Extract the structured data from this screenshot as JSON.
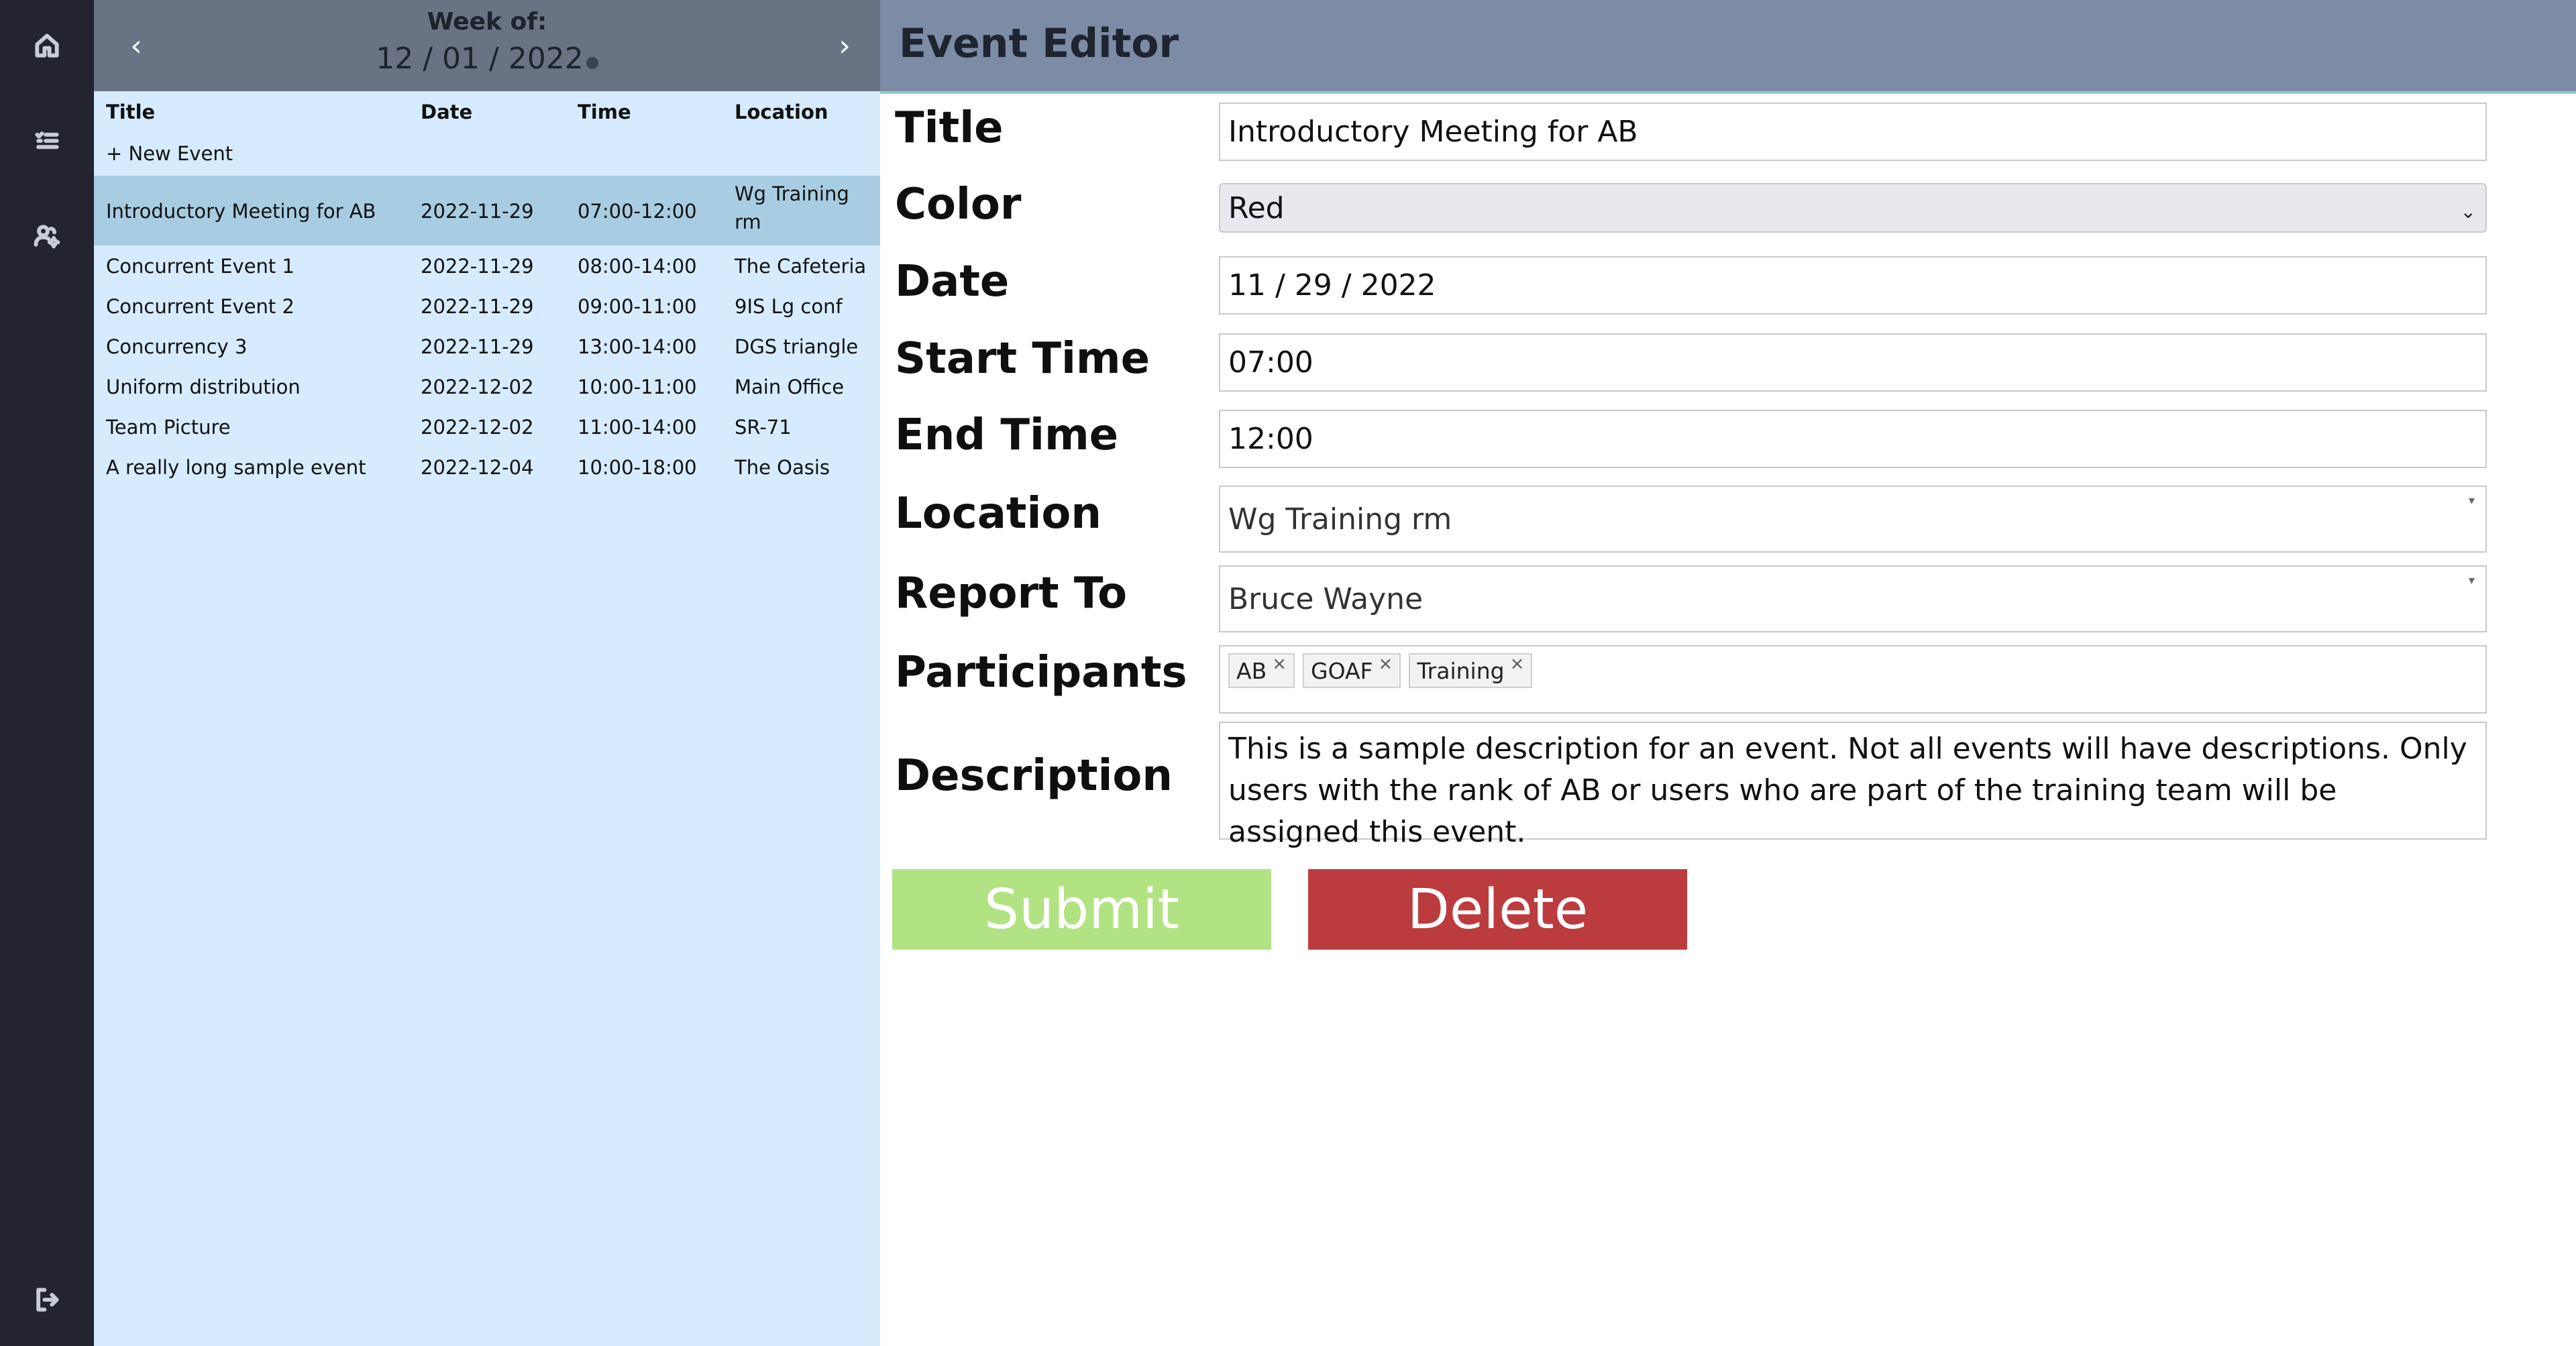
{
  "nav": {
    "items": [
      {
        "name": "home-icon"
      },
      {
        "name": "event-list-icon"
      },
      {
        "name": "users-settings-icon"
      }
    ],
    "bottom": {
      "name": "logout-icon"
    }
  },
  "week": {
    "label": "Week of:",
    "date": "12 / 01 / 2022",
    "prev_icon": "‹",
    "next_icon": "›"
  },
  "table": {
    "headers": {
      "title": "Title",
      "date": "Date",
      "time": "Time",
      "location": "Location"
    },
    "new_event": "+ New Event",
    "rows": [
      {
        "title": "Introductory Meeting for AB",
        "date": "2022-11-29",
        "time": "07:00-12:00",
        "location_line1": "Wg Training",
        "location_line2": "rm"
      },
      {
        "title": "Concurrent Event 1",
        "date": "2022-11-29",
        "time": "08:00-14:00",
        "location_line1": "The Cafeteria"
      },
      {
        "title": "Concurrent Event 2",
        "date": "2022-11-29",
        "time": "09:00-11:00",
        "location_line1": "9IS Lg conf"
      },
      {
        "title": "Concurrency 3",
        "date": "2022-11-29",
        "time": "13:00-14:00",
        "location_line1": "DGS triangle"
      },
      {
        "title": "Uniform distribution",
        "date": "2022-12-02",
        "time": "10:00-11:00",
        "location_line1": "Main Office"
      },
      {
        "title": "Team Picture",
        "date": "2022-12-02",
        "time": "11:00-14:00",
        "location_line1": "SR-71"
      },
      {
        "title": "A really long sample event",
        "date": "2022-12-04",
        "time": "10:00-18:00",
        "location_line1": "The Oasis"
      }
    ]
  },
  "editor": {
    "heading": "Event Editor",
    "labels": {
      "title": "Title",
      "color": "Color",
      "date": "Date",
      "start_time": "Start Time",
      "end_time": "End Time",
      "location": "Location",
      "report_to": "Report To",
      "participants": "Participants",
      "description": "Description"
    },
    "values": {
      "title": "Introductory Meeting for AB",
      "color": "Red",
      "date": "11 / 29 / 2022",
      "start_time": "07:00",
      "end_time": "12:00",
      "location": "Wg Training rm",
      "report_to": "Bruce Wayne",
      "participants": [
        "AB",
        "GOAF",
        "Training"
      ],
      "description": "This is a sample description for an event. Not all events will have descriptions. Only users with the rank of AB or users who are part of the training team will be assigned this event."
    },
    "buttons": {
      "submit": "Submit",
      "delete": "Delete"
    },
    "colors": {
      "submit": "#b2e382",
      "delete": "#bc3b3e"
    }
  }
}
